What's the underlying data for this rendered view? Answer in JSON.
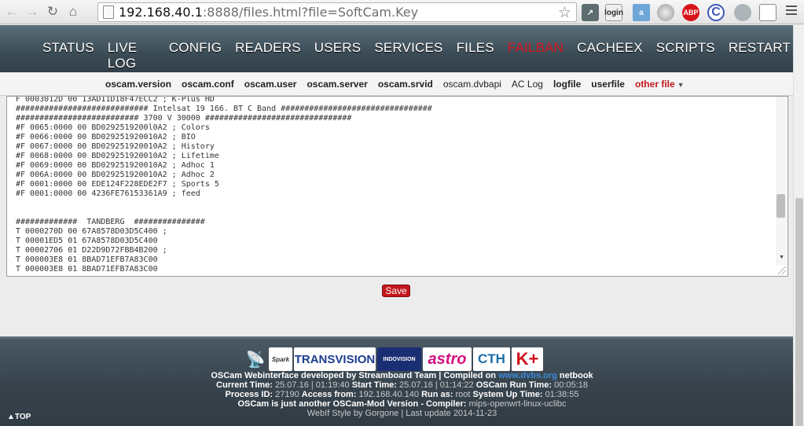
{
  "browser": {
    "url_host": "192.168.40.1",
    "url_rest": ":8888/files.html?file=SoftCam.Key",
    "extension_login_label": "login",
    "extension_abp_label": "ABP",
    "extension_c_label": "C"
  },
  "nav": {
    "items": [
      "STATUS",
      "LIVE LOG",
      "CONFIG",
      "READERS",
      "USERS",
      "SERVICES",
      "FILES",
      "FAILBAN",
      "CACHEEX",
      "SCRIPTS",
      "RESTART"
    ],
    "active": "FAILBAN"
  },
  "subnav": {
    "items": [
      "oscam.version",
      "oscam.conf",
      "oscam.user",
      "oscam.server",
      "oscam.srvid",
      "oscam.dvbapi",
      "AC Log",
      "logfile",
      "userfile",
      "other file"
    ]
  },
  "editor": {
    "lines": [
      "F 0003012D 00 13AD11D18F47ECC2 ; K-Plus HD",
      "############################ Intelsat 19 166. BT C Band ################################",
      "########################## 3700 V 30000 ###############################",
      "#F 0065:0000 00 BD0292519200l0A2 ; Colors",
      "#F 0066:0000 00 BD029251920010A2 ; BIO",
      "#F 0067:0000 00 BD029251920010A2 ; History",
      "#F 0068:0000 00 BD029251920010A2 ; Lifetime",
      "#F 0069:0000 00 BD029251920010A2 ; Adhoc 1",
      "#F 006A:0000 00 BD029251920010A2 ; Adhoc 2",
      "#F 0001:0000 00 EDE124F228EDE2F7 ; Sports 5",
      "#F 0001:0000 00 4236FE76153361A9 ; feed",
      "",
      "",
      "#############  TANDBERG  ###############",
      "T 0000270D 00 67A8578D03D5C400 ;",
      "T 00001ED5 01 67A8578D03D5C400",
      "T 00002706 01 D22D9D72FBB4B200 ;",
      "T 000003E8 01 8BAD71EFB7A83C00",
      "T 000003E8 01 8BAD71EFB7A83C00"
    ]
  },
  "save_label": "Save",
  "footer": {
    "logos": [
      "Spark",
      "TRANSVISION",
      "INDOVISION",
      "astro",
      "CTH",
      "K+"
    ],
    "line1_a": "OSCam Webinterface developed by Streamboard Team | Compiled on ",
    "line1_link": "www.dvbs.org",
    "line1_b": " netbook",
    "current_time_label": "Current Time:",
    "current_time": "25.07.16 | 01:19:40",
    "start_time_label": "Start Time:",
    "start_time": "25.07.16 | 01:14:22",
    "run_time_label": "OSCam Run Time:",
    "run_time": "00:05:18",
    "process_id_label": "Process ID:",
    "process_id": "27190",
    "access_from_label": "Access from:",
    "access_from": "192.168.40.140",
    "run_as_label": "Run as:",
    "run_as": "root",
    "uptime_label": "System Up Time:",
    "uptime": "01:38:55",
    "version_label": "OSCam is just another OSCam-Mod Version - Compiler:",
    "compiler": "mips-openwrt-linux-uclibc",
    "style_line": "WebIf Style by Gorgone | Last update 2014-11-23",
    "top_link": "▲TOP"
  }
}
